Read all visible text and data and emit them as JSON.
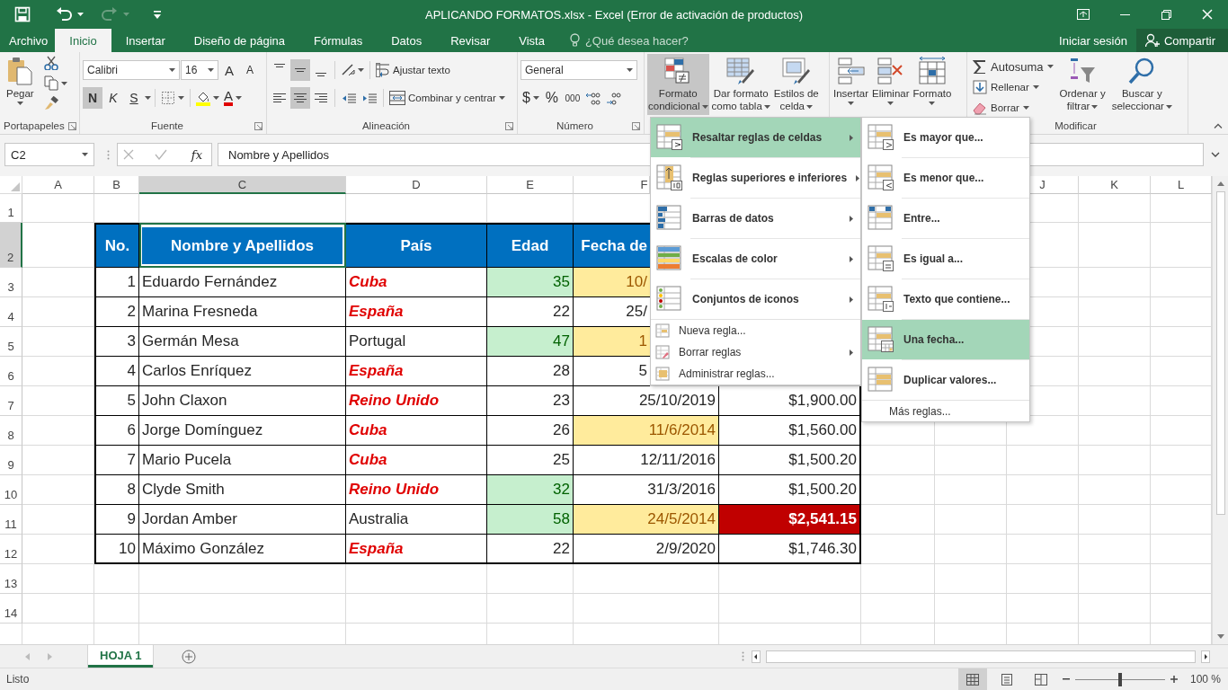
{
  "window": {
    "title": "APLICANDO FORMATOS.xlsx - Excel (Error de activación de productos)"
  },
  "quick_access": [
    {
      "kind": "save",
      "disabled": false
    },
    {
      "kind": "undo",
      "disabled": false
    },
    {
      "kind": "redo",
      "disabled": true
    },
    {
      "kind": "customize",
      "disabled": false
    }
  ],
  "tabs": [
    {
      "label": "Archivo",
      "selected": false
    },
    {
      "label": "Inicio",
      "selected": true
    },
    {
      "label": "Insertar",
      "selected": false
    },
    {
      "label": "Diseño de página",
      "selected": false
    },
    {
      "label": "Fórmulas",
      "selected": false
    },
    {
      "label": "Datos",
      "selected": false
    },
    {
      "label": "Revisar",
      "selected": false
    },
    {
      "label": "Vista",
      "selected": false
    }
  ],
  "tell_me": {
    "placeholder": "¿Qué desea hacer?"
  },
  "account": {
    "sign_in": "Iniciar sesión",
    "share": "Compartir"
  },
  "ribbon": {
    "groups": [
      {
        "kind": "clipboard",
        "label": "Portapapeles",
        "paste": "Pegar"
      },
      {
        "kind": "font",
        "label": "Fuente",
        "font": "Calibri",
        "size": "16",
        "grow": "A",
        "shrink": "A",
        "color_letter": "A",
        "style_buttons": [
          {
            "label": "N",
            "on": true
          },
          {
            "label": "K",
            "on": false
          },
          {
            "label": "S",
            "on": false
          }
        ]
      },
      {
        "kind": "alignment",
        "label": "Alineación",
        "vertical": [
          {
            "selected": false
          },
          {
            "selected": true
          },
          {
            "selected": false
          }
        ],
        "horizontal": [
          {
            "selected": false
          },
          {
            "selected": true
          },
          {
            "selected": false
          }
        ],
        "wrap": "Ajustar texto",
        "merge": "Combinar y centrar"
      },
      {
        "kind": "number",
        "label": "Número",
        "format": "General",
        "currency": "$",
        "percent": "%",
        "thousands": "000"
      },
      {
        "kind": "styles",
        "buttons": [
          {
            "label": [
              "Formato",
              "condicional"
            ],
            "selected": true
          },
          {
            "label": [
              "Dar formato",
              "como tabla"
            ],
            "selected": false
          },
          {
            "label": [
              "Estilos de",
              "celda"
            ],
            "selected": false
          }
        ]
      },
      {
        "kind": "cells",
        "buttons": [
          {
            "label": [
              "Insertar"
            ],
            "selected": false
          },
          {
            "label": [
              "Eliminar"
            ],
            "selected": false
          },
          {
            "label": [
              "Formato"
            ],
            "selected": false
          }
        ]
      },
      {
        "kind": "editing",
        "label": "Modificar",
        "small": [
          "Autosuma",
          "Rellenar",
          "Borrar"
        ],
        "big": [
          [
            "Ordenar y",
            "filtrar"
          ],
          [
            "Buscar y",
            "seleccionar"
          ]
        ]
      }
    ]
  },
  "formula_bar": {
    "name_box": "C2",
    "commit_disabled": true,
    "fx": "fx",
    "value": "Nombre y Apellidos"
  },
  "sheet": {
    "column_headers": [
      {
        "label": "A",
        "selected": false
      },
      {
        "label": "B",
        "selected": false
      },
      {
        "label": "C",
        "selected": true
      },
      {
        "label": "D",
        "selected": false
      },
      {
        "label": "E",
        "selected": false
      },
      {
        "label": "F",
        "selected": false,
        "clipped": true
      },
      {
        "label": "J",
        "selected": false,
        "clipped": true
      },
      {
        "label": "K",
        "selected": false
      },
      {
        "label": "L",
        "selected": false
      }
    ],
    "rows": [
      {
        "header": "1",
        "selected": false,
        "cells": []
      },
      {
        "header": "2",
        "selected": true,
        "cells": [
          {
            "text": ""
          },
          {
            "text": "No.",
            "kind": "header"
          },
          {
            "text": "Nombre y Apellidos",
            "kind": "header"
          },
          {
            "text": "País",
            "kind": "header"
          },
          {
            "text": "Edad",
            "kind": "header"
          },
          {
            "text": "Fecha de",
            "kind": "header",
            "clipped": true
          }
        ]
      },
      {
        "header": "3",
        "selected": false,
        "cells": [
          {
            "text": ""
          },
          {
            "text": "1",
            "kind": "number"
          },
          {
            "text": "Eduardo Fernández",
            "kind": "text"
          },
          {
            "text": "Cuba",
            "kind": "alert"
          },
          {
            "text": "35",
            "kind": "good"
          },
          {
            "text": "10/",
            "kind": "neutral",
            "clipped": true
          }
        ]
      },
      {
        "header": "4",
        "selected": false,
        "cells": [
          {
            "text": ""
          },
          {
            "text": "2",
            "kind": "number"
          },
          {
            "text": "Marina Fresneda",
            "kind": "text"
          },
          {
            "text": "España",
            "kind": "alert"
          },
          {
            "text": "22",
            "kind": "number"
          },
          {
            "text": "25/",
            "kind": "number",
            "clipped": true
          }
        ]
      },
      {
        "header": "5",
        "selected": false,
        "cells": [
          {
            "text": ""
          },
          {
            "text": "3",
            "kind": "number"
          },
          {
            "text": "Germán Mesa",
            "kind": "text"
          },
          {
            "text": "Portugal",
            "kind": "text"
          },
          {
            "text": "47",
            "kind": "good"
          },
          {
            "text": "1",
            "kind": "neutral",
            "clipped": true
          }
        ]
      },
      {
        "header": "6",
        "selected": false,
        "cells": [
          {
            "text": ""
          },
          {
            "text": "4",
            "kind": "number"
          },
          {
            "text": "Carlos Enríquez",
            "kind": "text"
          },
          {
            "text": "España",
            "kind": "alert"
          },
          {
            "text": "28",
            "kind": "number"
          },
          {
            "text": "5",
            "kind": "number",
            "clipped": true
          }
        ]
      },
      {
        "header": "7",
        "selected": false,
        "cells": [
          {
            "text": ""
          },
          {
            "text": "5",
            "kind": "number"
          },
          {
            "text": "John Claxon",
            "kind": "text"
          },
          {
            "text": "Reino Unido",
            "kind": "alert"
          },
          {
            "text": "23",
            "kind": "number"
          },
          {
            "text": "25/10/2019",
            "kind": "number"
          },
          {
            "text": "$1,900.00",
            "kind": "number"
          }
        ]
      },
      {
        "header": "8",
        "selected": false,
        "cells": [
          {
            "text": ""
          },
          {
            "text": "6",
            "kind": "number"
          },
          {
            "text": "Jorge Domínguez",
            "kind": "text"
          },
          {
            "text": "Cuba",
            "kind": "alert"
          },
          {
            "text": "26",
            "kind": "number"
          },
          {
            "text": "11/6/2014",
            "kind": "neutral"
          },
          {
            "text": "$1,560.00",
            "kind": "number"
          }
        ]
      },
      {
        "header": "9",
        "selected": false,
        "cells": [
          {
            "text": ""
          },
          {
            "text": "7",
            "kind": "number"
          },
          {
            "text": "Mario Pucela",
            "kind": "text"
          },
          {
            "text": "Cuba",
            "kind": "alert"
          },
          {
            "text": "25",
            "kind": "number"
          },
          {
            "text": "12/11/2016",
            "kind": "number"
          },
          {
            "text": "$1,500.20",
            "kind": "number"
          }
        ]
      },
      {
        "header": "10",
        "selected": false,
        "cells": [
          {
            "text": ""
          },
          {
            "text": "8",
            "kind": "number"
          },
          {
            "text": "Clyde Smith",
            "kind": "text"
          },
          {
            "text": "Reino Unido",
            "kind": "alert"
          },
          {
            "text": "32",
            "kind": "good"
          },
          {
            "text": "31/3/2016",
            "kind": "number"
          },
          {
            "text": "$1,500.20",
            "kind": "number"
          }
        ]
      },
      {
        "header": "11",
        "selected": false,
        "cells": [
          {
            "text": ""
          },
          {
            "text": "9",
            "kind": "number"
          },
          {
            "text": "Jordan Amber",
            "kind": "text"
          },
          {
            "text": "Australia",
            "kind": "text"
          },
          {
            "text": "58",
            "kind": "good"
          },
          {
            "text": "24/5/2014",
            "kind": "neutral"
          },
          {
            "text": "$2,541.15",
            "kind": "bad"
          }
        ]
      },
      {
        "header": "12",
        "selected": false,
        "cells": [
          {
            "text": ""
          },
          {
            "text": "10",
            "kind": "number"
          },
          {
            "text": "Máximo González",
            "kind": "text"
          },
          {
            "text": "España",
            "kind": "alert"
          },
          {
            "text": "22",
            "kind": "number"
          },
          {
            "text": "2/9/2020",
            "kind": "number"
          },
          {
            "text": "$1,746.30",
            "kind": "number"
          }
        ]
      },
      {
        "header": "13",
        "selected": false,
        "cells": []
      },
      {
        "header": "14",
        "selected": false,
        "cells": []
      }
    ]
  },
  "menu": {
    "items": [
      {
        "label": "Resaltar reglas de celdas",
        "kind": "large",
        "submenu": true,
        "selected": true
      },
      {
        "label": "Reglas superiores e inferiores",
        "kind": "large",
        "submenu": true,
        "selected": false
      },
      {
        "label": "Barras de datos",
        "kind": "large",
        "submenu": true,
        "selected": false
      },
      {
        "label": "Escalas de color",
        "kind": "large",
        "submenu": true,
        "selected": false
      },
      {
        "label": "Conjuntos de iconos",
        "kind": "large",
        "submenu": true,
        "selected": false
      },
      {
        "label": "Nueva regla...",
        "kind": "small",
        "submenu": false,
        "selected": false
      },
      {
        "label": "Borrar reglas",
        "kind": "small",
        "submenu": true,
        "selected": false
      },
      {
        "label": "Administrar reglas...",
        "kind": "small",
        "submenu": false,
        "selected": false
      }
    ]
  },
  "submenu": {
    "items": [
      {
        "label": "Es mayor que...",
        "kind": "large",
        "selected": false
      },
      {
        "label": "Es menor que...",
        "kind": "large",
        "selected": false
      },
      {
        "label": "Entre...",
        "kind": "large",
        "selected": false
      },
      {
        "label": "Es igual a...",
        "kind": "large",
        "selected": false
      },
      {
        "label": "Texto que contiene...",
        "kind": "large",
        "selected": false
      },
      {
        "label": "Una fecha...",
        "kind": "large",
        "selected": true
      },
      {
        "label": "Duplicar valores...",
        "kind": "large",
        "selected": false
      },
      {
        "label": "Más reglas...",
        "kind": "link",
        "selected": false
      }
    ]
  },
  "sheet_tabs": [
    {
      "label": "HOJA 1",
      "selected": true
    }
  ],
  "status_bar": {
    "status": "Listo",
    "views": [
      {
        "selected": true
      },
      {
        "selected": false
      },
      {
        "selected": false
      }
    ],
    "zoom": {
      "level": 0.5,
      "reading": "100 %"
    }
  }
}
